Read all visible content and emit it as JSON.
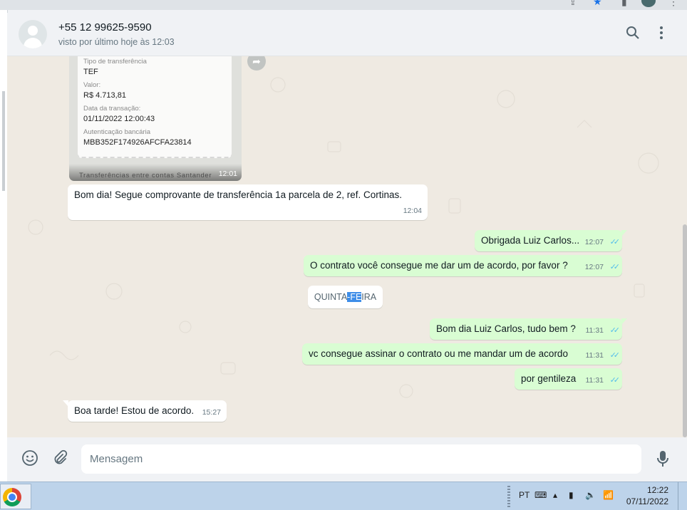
{
  "contact": {
    "name": "+55 12 99625-9590",
    "last_seen": "visto por último hoje às 12:03"
  },
  "header_icons": [
    "search-icon",
    "menu-kebab-icon"
  ],
  "receipt": {
    "fields": [
      {
        "label": "Tipo de transferência",
        "value": "TEF"
      },
      {
        "label": "Valor:",
        "value": "R$ 4.713,81"
      },
      {
        "label": "Data da transação:",
        "value": "01/11/2022 12:00:43"
      },
      {
        "label": "Autenticação bancária",
        "value": "MBB352F174926AFCFA23814"
      }
    ],
    "caption": "Transferências entre contas Santander",
    "time": "12:01"
  },
  "messages": [
    {
      "direction": "in",
      "text": "Bom dia! Segue comprovante de transferência 1a parcela de 2, ref. Cortinas.",
      "time": "12:04"
    },
    {
      "direction": "out",
      "text": "Obrigada Luiz Carlos...",
      "time": "12:07"
    },
    {
      "direction": "out",
      "text": "O contrato você consegue me dar um de acordo, por favor ?",
      "time": "12:07"
    },
    {
      "direction": "out",
      "text": "Bom dia Luiz Carlos, tudo bem ?",
      "time": "11:31"
    },
    {
      "direction": "out",
      "text": "vc consegue assinar o contrato ou me mandar um de acordo",
      "time": "11:31"
    },
    {
      "direction": "out",
      "text": "por gentileza",
      "time": "11:31"
    },
    {
      "direction": "in",
      "text": "Boa tarde! Estou de acordo.",
      "time": "15:27"
    }
  ],
  "date_divider": {
    "before": "QUINTA",
    "selected": "-FE",
    "after": "IRA"
  },
  "ticks": "✓✓",
  "composer": {
    "placeholder": "Mensagem"
  },
  "taskbar": {
    "language": "PT",
    "time": "12:22",
    "date": "07/11/2022"
  },
  "colors": {
    "outgoing_bubble": "#d9fdd3",
    "incoming_bubble": "#ffffff",
    "chat_background": "#efeae2",
    "read_ticks": "#53bdeb"
  }
}
